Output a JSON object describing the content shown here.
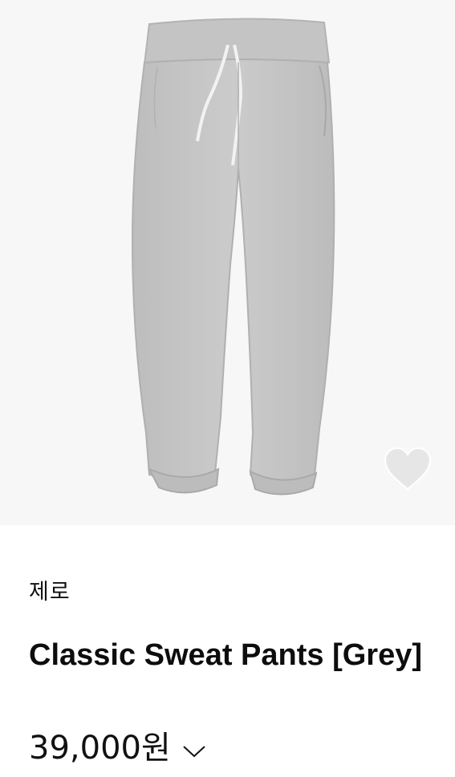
{
  "product": {
    "image": {
      "alt": "grey sweat pants"
    },
    "brand": "제로",
    "title": "Classic Sweat Pants [Grey]",
    "price": "39,000원"
  },
  "icons": {
    "wishlist": "heart-icon",
    "price_expand": "chevron-down-icon"
  },
  "colors": {
    "garment": "#c7c7c7",
    "background": "#f7f7f7",
    "heart": "#e6e6e6"
  }
}
